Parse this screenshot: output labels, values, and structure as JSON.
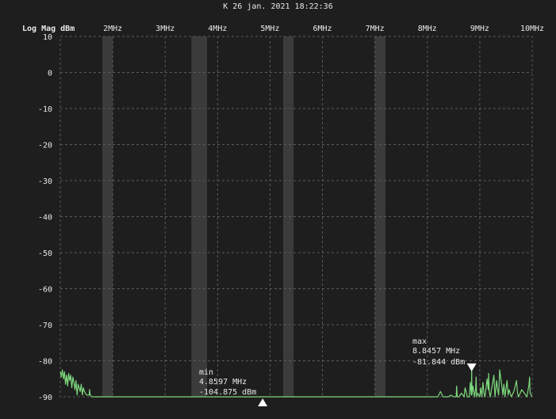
{
  "header": {
    "timestamp": "K 26 jan. 2021 18:22:36"
  },
  "colors": {
    "background": "#1e1e1e",
    "grid": "#5a5a5a",
    "trace": "#7ed87e",
    "band": "#3b3b3b",
    "text": "#e8e8e8"
  },
  "chart_data": {
    "type": "line",
    "title": "K 26 jan. 2021 18:22:36",
    "ylabel": "Log Mag dBm",
    "xlabel": "",
    "xlim": [
      1.0,
      10.0
    ],
    "ylim": [
      -90,
      10
    ],
    "grid": true,
    "x_ticks": [
      2,
      3,
      4,
      5,
      6,
      7,
      8,
      9,
      10
    ],
    "x_tick_labels": [
      "2MHz",
      "3MHz",
      "4MHz",
      "5MHz",
      "6MHz",
      "7MHz",
      "8MHz",
      "9MHz",
      "10MHz"
    ],
    "y_ticks": [
      10,
      0,
      -10,
      -20,
      -30,
      -40,
      -50,
      -60,
      -70,
      -80,
      -90
    ],
    "y_tick_labels": [
      "10",
      "0",
      "-10",
      "-20",
      "-30",
      "-40",
      "-50",
      "-60",
      "-70",
      "-80",
      "-90"
    ],
    "bands": [
      {
        "start": 1.8,
        "end": 2.0
      },
      {
        "start": 3.5,
        "end": 3.8
      },
      {
        "start": 5.25,
        "end": 5.45
      },
      {
        "start": 7.0,
        "end": 7.2
      }
    ],
    "markers": [
      {
        "label": "min",
        "freq_text": "4.8597 MHz",
        "level_text": "-104.875 dBm",
        "freq": 4.8597,
        "level": -104.875
      },
      {
        "label": "max",
        "freq_text": "8.8457 MHz",
        "level_text": "-81.844 dBm",
        "freq": 8.8457,
        "level": -81.844
      }
    ],
    "series": [
      {
        "x": [
          1.0,
          1.02,
          1.04,
          1.06,
          1.08,
          1.1,
          1.12,
          1.14,
          1.16,
          1.18,
          1.2,
          1.22,
          1.24,
          1.26,
          1.28,
          1.3,
          1.32,
          1.34,
          1.36,
          1.38,
          1.4,
          1.42,
          1.44,
          1.46,
          1.5,
          1.55,
          1.56,
          1.57,
          1.6,
          1.7,
          2.0,
          3.0,
          4.0,
          5.0,
          6.0,
          7.0,
          7.5,
          8.0,
          8.2,
          8.25,
          8.3,
          8.4,
          8.45,
          8.5,
          8.55,
          8.56,
          8.57,
          8.6,
          8.65,
          8.7,
          8.72,
          8.74,
          8.76,
          8.8,
          8.82,
          8.84,
          8.8457,
          8.85,
          8.87,
          8.9,
          8.92,
          8.93,
          8.94,
          8.96,
          9.0,
          9.02,
          9.04,
          9.06,
          9.08,
          9.1,
          9.14,
          9.16,
          9.17,
          9.18,
          9.2,
          9.24,
          9.27,
          9.28,
          9.29,
          9.32,
          9.34,
          9.36,
          9.38,
          9.42,
          9.44,
          9.46,
          9.48,
          9.52,
          9.54,
          9.56,
          9.6,
          9.65,
          9.7,
          9.72,
          9.74,
          9.8,
          9.9,
          9.94,
          9.95,
          9.96,
          10.0
        ],
        "y": [
          -83,
          -84.5,
          -82.5,
          -85,
          -83,
          -86.5,
          -84,
          -87,
          -83.5,
          -85.5,
          -84,
          -87.5,
          -84.5,
          -86,
          -88,
          -85.5,
          -89.5,
          -86.5,
          -87.5,
          -88.5,
          -86.5,
          -89.5,
          -87.5,
          -88.5,
          -89.5,
          -89.5,
          -88,
          -89.5,
          -90,
          -90,
          -90,
          -90,
          -90,
          -90,
          -90,
          -90,
          -90,
          -90,
          -90,
          -88.5,
          -90,
          -90,
          -89.5,
          -90,
          -90,
          -87,
          -90,
          -90,
          -89,
          -90,
          -87.5,
          -88.5,
          -90,
          -90,
          -86,
          -89.5,
          -81.8,
          -89.5,
          -87,
          -90,
          -88,
          -84.5,
          -90,
          -89,
          -90,
          -87.5,
          -90,
          -86,
          -89,
          -90,
          -85,
          -88,
          -83.5,
          -88.5,
          -90,
          -86.5,
          -84,
          -87.5,
          -90,
          -85.5,
          -88,
          -89.5,
          -82.5,
          -87,
          -89.5,
          -86.5,
          -90,
          -85.5,
          -89.5,
          -88,
          -90,
          -88.5,
          -85.5,
          -89,
          -90,
          -88,
          -90,
          -86.5,
          -84.5,
          -89,
          -90
        ]
      }
    ]
  }
}
